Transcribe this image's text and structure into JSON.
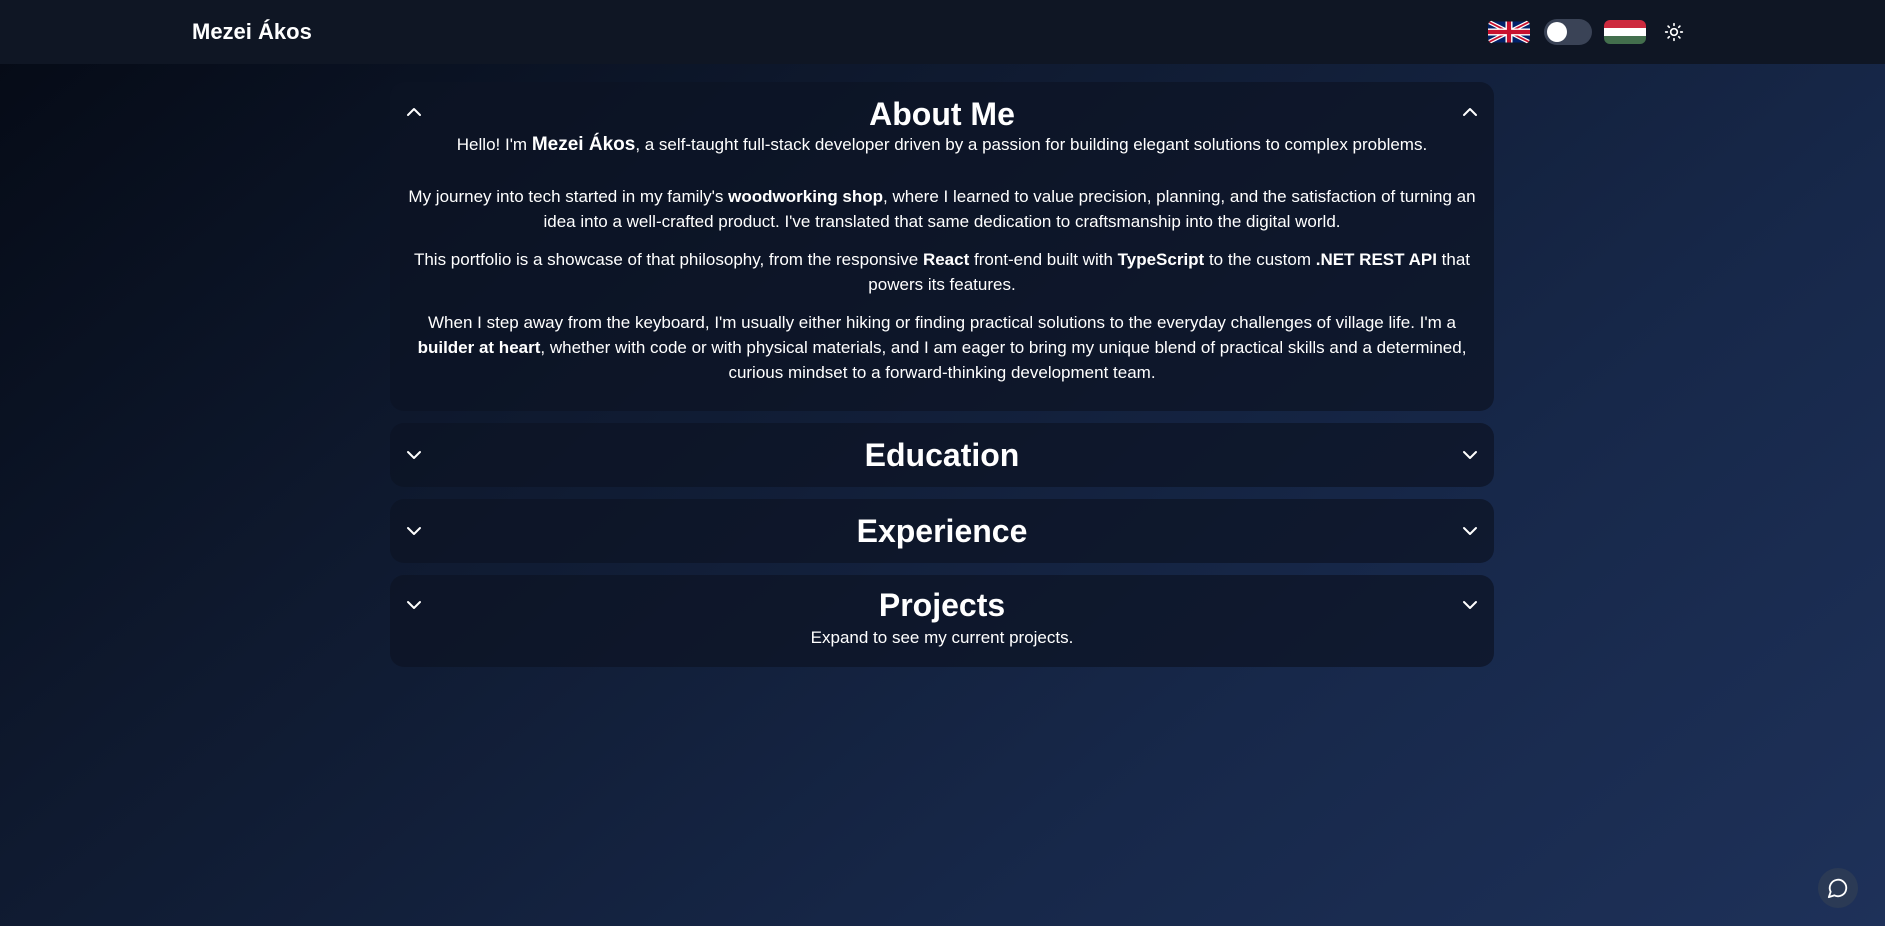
{
  "navbar": {
    "brand": "Mezei Ákos",
    "language_toggle": {
      "left_flag": "uk-flag-icon",
      "right_flag": "hungary-flag-icon",
      "selected": "en"
    },
    "theme_icon": "sun-icon"
  },
  "sections": {
    "about": {
      "title": "About Me",
      "expanded": true,
      "p1": {
        "t1": "Hello! I'm ",
        "b1": "Mezei Ákos",
        "t2": ", a self-taught full-stack developer driven by a passion for building elegant solutions to complex problems."
      },
      "p2": {
        "t1": "My journey into tech started in my family's ",
        "b1": "woodworking shop",
        "t2": ", where I learned to value precision, planning, and the satisfaction of turning an idea into a well-crafted product. I've translated that same dedication to craftsmanship into the digital world."
      },
      "p3": {
        "t1": "This portfolio is a showcase of that philosophy, from the responsive ",
        "b1": "React",
        "t2": " front-end built with ",
        "b2": "TypeScript",
        "t3": " to the custom ",
        "b3": ".NET REST API",
        "t4": " that powers its features."
      },
      "p4": {
        "t1": "When I step away from the keyboard, I'm usually either hiking or finding practical solutions to the everyday challenges of village life. I'm a ",
        "b1": "builder at heart",
        "t2": ", whether with code or with physical materials, and I am eager to bring my unique blend of practical skills and a determined, curious mindset to a forward-thinking development team."
      }
    },
    "education": {
      "title": "Education",
      "expanded": false
    },
    "experience": {
      "title": "Experience",
      "expanded": false
    },
    "projects": {
      "title": "Projects",
      "expanded": false,
      "subtitle": "Expand to see my current projects."
    }
  },
  "chat": {
    "icon": "chat-bubble-icon"
  },
  "colors": {
    "navbar_bg": "#0f1624",
    "card_bg": "#0d1424",
    "toggle_track": "#3a4356",
    "text": "#ffffff"
  }
}
